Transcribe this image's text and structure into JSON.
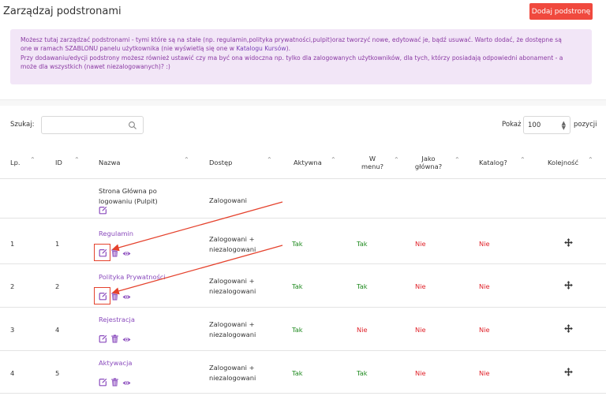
{
  "page": {
    "title": "Zarządzaj podstronami",
    "add_button": "Dodaj podstronę",
    "info": {
      "line1": "Możesz tutaj zarządzać podstronami - tymi które są na stałe (np. regulamin,polityka prywatności,pulpit)oraz tworzyć nowe, edytować je, bądź usuwać. Warto dodać, że dostępne są",
      "line2_prefix": "one w ramach SZABLONU panelu użytkownika (nie wyświetlą się one w ",
      "line2_link": "Katalogu Kursów",
      "line2_suffix": ").",
      "line3": "Przy dodawaniu/edycji podstrony możesz również ustawić czy ma być ona widoczna np. tylko dla zalogowanych użytkowników, dla tych, którzy posiadają odpowiedni abonament - a",
      "line4": "może dla wszystkich (nawet niezalogowanych)? :)"
    }
  },
  "toolbar": {
    "search_label": "Szukaj:",
    "search_value": "",
    "show_label": "Pokaż",
    "show_value": "100",
    "per_label": "pozycji"
  },
  "table": {
    "headers": {
      "lp": "Lp.",
      "id": "ID",
      "name": "Nazwa",
      "access": "Dostęp",
      "active": "Aktywna",
      "menu_1": "W",
      "menu_2": "menu?",
      "main_1": "Jako",
      "main_2": "główna?",
      "catalog": "Katalog?",
      "order": "Kolejność"
    },
    "rows": [
      {
        "lp": "",
        "id": "",
        "name_1": "Strona Główna po",
        "name_2": "logowaniu (Pulpit)",
        "access_1": "Zalogowani",
        "access_2": ""
      },
      {
        "lp": "1",
        "id": "1",
        "name": "Regulamin",
        "access_1": "Zalogowani +",
        "access_2": "niezalogowani",
        "active": "Tak",
        "menu": "Tak",
        "main": "Nie",
        "catalog": "Nie"
      },
      {
        "lp": "2",
        "id": "2",
        "name": "Polityka Prywatności",
        "access_1": "Zalogowani +",
        "access_2": "niezalogowani",
        "active": "Tak",
        "menu": "Tak",
        "main": "Nie",
        "catalog": "Nie"
      },
      {
        "lp": "3",
        "id": "4",
        "name": "Rejestracja",
        "access_1": "Zalogowani +",
        "access_2": "niezalogowani",
        "active": "Tak",
        "menu": "Nie",
        "main": "Nie",
        "catalog": "Nie"
      },
      {
        "lp": "4",
        "id": "5",
        "name": "Aktywacja",
        "access_1": "Zalogowani +",
        "access_2": "niezalogowani",
        "active": "Tak",
        "menu": "Tak",
        "main": "Nie",
        "catalog": "Nie"
      }
    ]
  },
  "colors": {
    "accent": "#8a4bbd",
    "danger_button": "#f0493e",
    "yes": "#1f8a1f",
    "no": "#e0222a",
    "annotation": "#e5422d"
  },
  "icons": {
    "edit": "edit-icon",
    "delete": "trash-icon",
    "view": "eye-icon",
    "move": "move-icon",
    "search": "search-icon"
  }
}
